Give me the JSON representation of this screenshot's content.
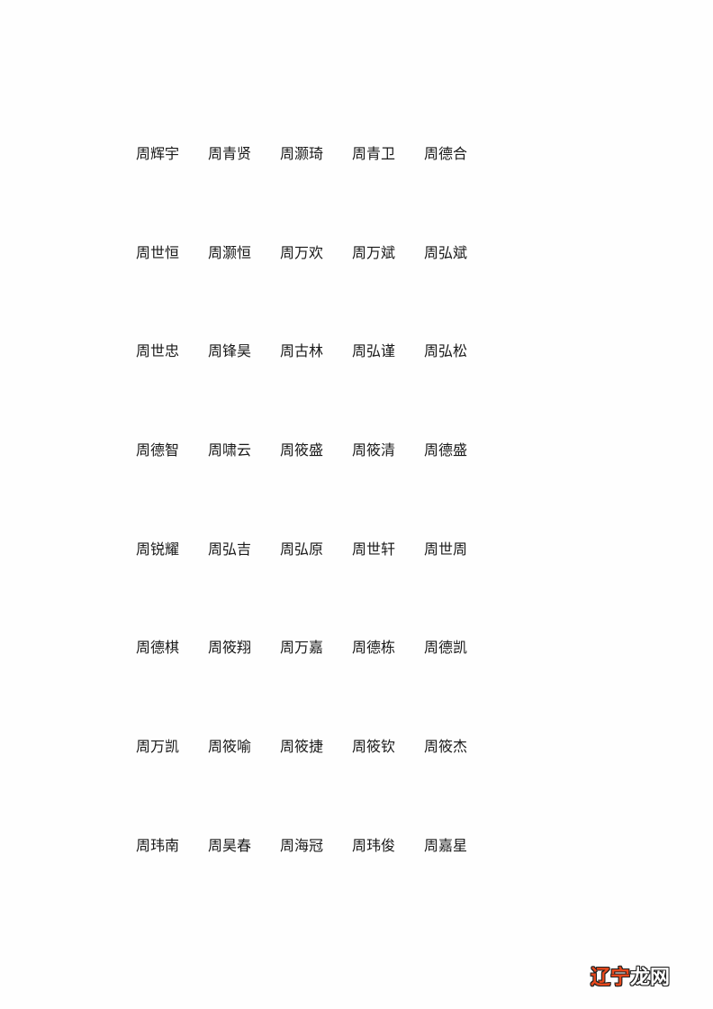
{
  "document": {
    "rows": [
      [
        "周辉宇",
        "周青贤",
        "周灏琦",
        "周青卫",
        "周德合"
      ],
      [
        "周世恒",
        "周灏恒",
        "周万欢",
        "周万斌",
        "周弘斌"
      ],
      [
        "周世忠",
        "周锋昊",
        "周古林",
        "周弘谨",
        "周弘松"
      ],
      [
        "周德智",
        "周啸云",
        "周筱盛",
        "周筱清",
        "周德盛"
      ],
      [
        "周锐耀",
        "周弘吉",
        "周弘原",
        "周世轩",
        "周世周"
      ],
      [
        "周德棋",
        "周筱翔",
        "周万嘉",
        "周德栋",
        "周德凯"
      ],
      [
        "周万凯",
        "周筱喻",
        "周筱捷",
        "周筱钦",
        "周筱杰"
      ],
      [
        "周玮南",
        "周昊春",
        "周海冠",
        "周玮俊",
        "周嘉星"
      ]
    ]
  },
  "watermark": {
    "part_a": "辽宁",
    "part_b": "龙网",
    "color_a": "#e8481c",
    "color_b": "#ffffff",
    "outline_color": "#222222"
  }
}
